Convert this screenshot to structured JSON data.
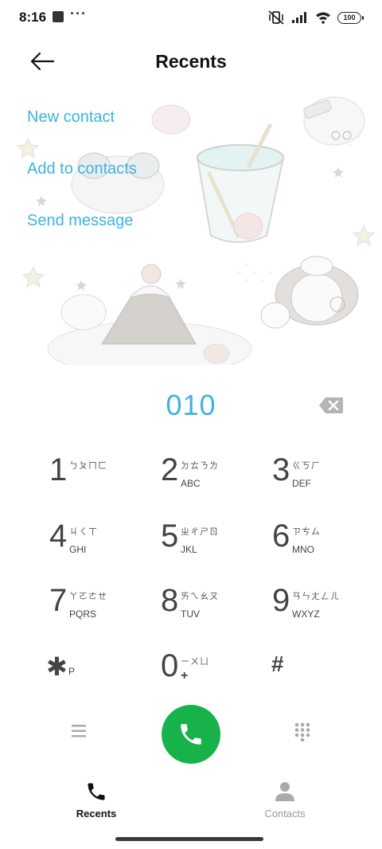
{
  "status_bar": {
    "time": "8:16",
    "overflow": "···",
    "battery": "100",
    "icons": [
      "app-notification-icon",
      "vibrate-off-icon",
      "signal-icon",
      "wifi-icon",
      "battery-icon"
    ]
  },
  "header": {
    "title": "Recents",
    "back_icon": "back-arrow-icon"
  },
  "actions": {
    "new_contact": "New contact",
    "add_to_contacts": "Add to contacts",
    "send_message": "Send message"
  },
  "dialer": {
    "number": "010",
    "backspace_icon": "backspace-icon"
  },
  "keypad": [
    {
      "digit": "1",
      "zhuyin": "ㄅㄆㄇㄈ",
      "letters": ""
    },
    {
      "digit": "2",
      "zhuyin": "ㄉㄊㄋㄌ",
      "letters": "ABC"
    },
    {
      "digit": "3",
      "zhuyin": "ㄍㄎㄏ",
      "letters": "DEF"
    },
    {
      "digit": "4",
      "zhuyin": "ㄐㄑㄒ",
      "letters": "GHI"
    },
    {
      "digit": "5",
      "zhuyin": "ㄓㄔㄕㄖ",
      "letters": "JKL"
    },
    {
      "digit": "6",
      "zhuyin": "ㄗㄘㄙ",
      "letters": "MNO"
    },
    {
      "digit": "7",
      "zhuyin": "ㄚㄛㄜㄝ",
      "letters": "PQRS"
    },
    {
      "digit": "8",
      "zhuyin": "ㄞㄟㄠㄡ",
      "letters": "TUV"
    },
    {
      "digit": "9",
      "zhuyin": "ㄢㄣㄤㄥㄦ",
      "letters": "WXYZ"
    },
    {
      "digit": "✱",
      "zhuyin": "",
      "letters": "P"
    },
    {
      "digit": "0",
      "zhuyin": "ㄧㄨㄩ",
      "letters": "+"
    },
    {
      "digit": "#",
      "zhuyin": "",
      "letters": ""
    }
  ],
  "bottom_actions": {
    "menu_icon": "menu-icon",
    "call_icon": "phone-icon",
    "dialpad_icon": "dialpad-icon",
    "call_color": "#18b24a"
  },
  "nav": {
    "recents": "Recents",
    "contacts": "Contacts"
  },
  "colors": {
    "accent": "#3fb3df",
    "call_green": "#18b24a"
  }
}
